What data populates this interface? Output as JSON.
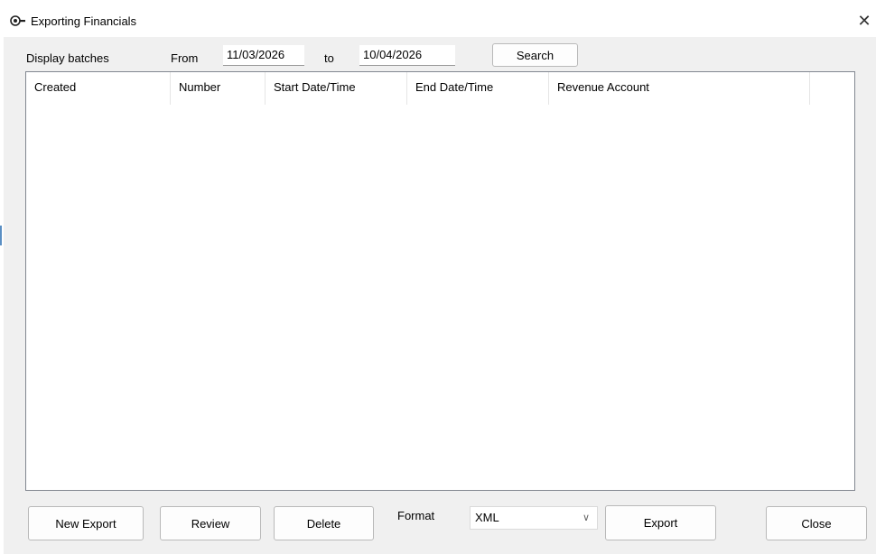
{
  "window": {
    "title": "Exporting Financials",
    "close_glyph": "✕"
  },
  "filter": {
    "display_label": "Display batches",
    "from_label": "From",
    "from_date": "11/03/2026",
    "to_label": "to",
    "to_date": "10/04/2026",
    "search_label": "Search"
  },
  "table": {
    "columns": [
      "Created",
      "Number",
      "Start Date/Time",
      "End Date/Time",
      "Revenue Account",
      ""
    ],
    "rows": []
  },
  "footer": {
    "new_export_label": "New Export",
    "review_label": "Review",
    "delete_label": "Delete",
    "format_label": "Format",
    "format_value": "XML",
    "export_label": "Export",
    "close_label": "Close"
  }
}
